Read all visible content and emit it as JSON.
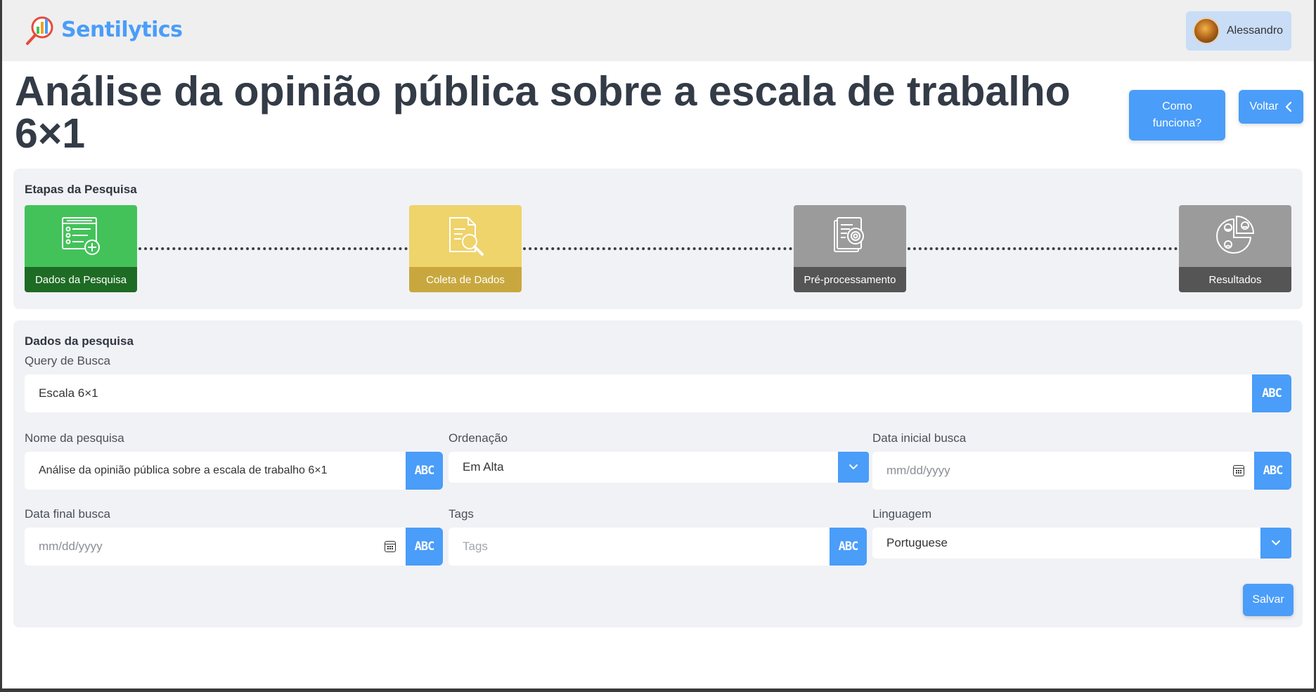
{
  "header": {
    "brand": "Sentilytics",
    "user": "Alessandro"
  },
  "page": {
    "title": "Análise da opinião pública sobre a escala de trabalho 6×1",
    "how_it_works_label": "Como funciona?",
    "back_label": "Voltar",
    "back_icon": "chevron-left-icon"
  },
  "steps": {
    "heading": "Etapas da Pesquisa",
    "items": [
      {
        "label": "Dados da Pesquisa",
        "icon": "form-add-icon",
        "status": "active",
        "color": "#43c25a"
      },
      {
        "label": "Coleta de Dados",
        "icon": "document-search-icon",
        "status": "current",
        "color": "#efd36b"
      },
      {
        "label": "Pré-processamento",
        "icon": "document-gear-icon",
        "status": "pending",
        "color": "#9b9b9b"
      },
      {
        "label": "Resultados",
        "icon": "sentiment-pie-icon",
        "status": "pending",
        "color": "#9b9b9b"
      }
    ]
  },
  "form": {
    "heading": "Dados da pesquisa",
    "abc_label": "ABC",
    "query": {
      "label": "Query de Busca",
      "value": "Escala 6×1"
    },
    "name": {
      "label": "Nome da pesquisa",
      "value": "Análise da opinião pública sobre a escala de trabalho 6×1"
    },
    "ordering": {
      "label": "Ordenação",
      "value": "Em Alta"
    },
    "start_date": {
      "label": "Data inicial busca",
      "placeholder": "mm/dd/yyyy"
    },
    "end_date": {
      "label": "Data final busca",
      "placeholder": "mm/dd/yyyy"
    },
    "tags": {
      "label": "Tags",
      "placeholder": "Tags"
    },
    "language": {
      "label": "Linguagem",
      "value": "Portuguese"
    },
    "save_label": "Salvar"
  },
  "colors": {
    "accent": "#4a9df8",
    "title": "#333b47",
    "panel": "#f1f2f6"
  }
}
